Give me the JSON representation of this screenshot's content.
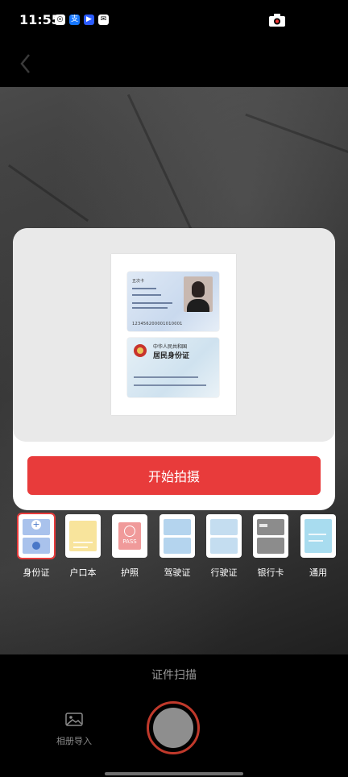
{
  "status_bar": {
    "time": "11:55",
    "icons": [
      "weibo-icon",
      "alipay-icon",
      "video-icon",
      "mail-icon"
    ],
    "right_icon": "camera-icon"
  },
  "nav": {
    "back_icon": "back-arrow-icon"
  },
  "card_panel": {
    "preview": {
      "front": {
        "name_text": "五次卡",
        "id_number": "123456200001010001"
      },
      "back": {
        "title_line1": "中华人民共和国",
        "title_line2": "居民身份证"
      }
    },
    "start_button_label": "开始拍摄"
  },
  "doc_types": [
    {
      "label": "身份证",
      "selected": true
    },
    {
      "label": "户口本",
      "selected": false
    },
    {
      "label": "护照",
      "selected": false
    },
    {
      "label": "驾驶证",
      "selected": false
    },
    {
      "label": "行驶证",
      "selected": false
    },
    {
      "label": "银行卡",
      "selected": false
    },
    {
      "label": "通用",
      "selected": false
    }
  ],
  "passport_badge_text": "PASS",
  "bottom": {
    "mode_label": "证件扫描",
    "album_label": "相册导入"
  },
  "colors": {
    "accent": "#e83b3b",
    "background": "#000000",
    "panel": "#ffffff"
  }
}
